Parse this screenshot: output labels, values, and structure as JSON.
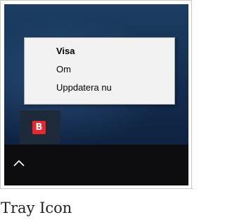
{
  "context_menu": {
    "items": [
      {
        "label": "Visa",
        "default": true
      },
      {
        "label": "Om",
        "default": false
      },
      {
        "label": "Uppdatera nu",
        "default": false
      }
    ]
  },
  "tray": {
    "app_icon": {
      "icon": "app-logo-icon",
      "glyph": "B",
      "color": "#e8262d"
    },
    "show_hidden_icon": "chevron-up-icon"
  },
  "caption": "Tray Icon"
}
